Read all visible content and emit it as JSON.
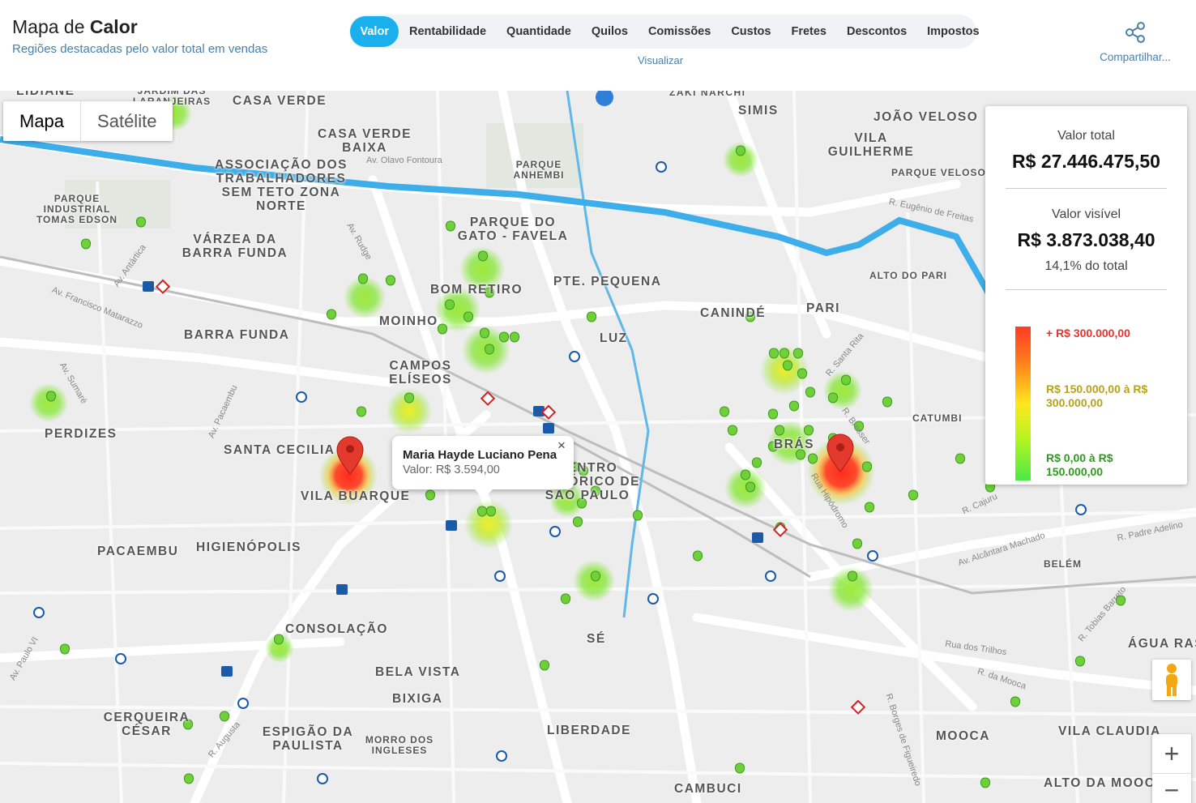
{
  "header": {
    "title_prefix": "Mapa de ",
    "title_bold": "Calor",
    "subtitle": "Regiões destacadas pelo valor total em vendas",
    "tabs": [
      "Valor",
      "Rentabilidade",
      "Quantidade",
      "Quilos",
      "Comissões",
      "Custos",
      "Fretes",
      "Descontos",
      "Impostos"
    ],
    "active_tab": "Valor",
    "visualizar_label": "Visualizar",
    "share_label": "Compartilhar..."
  },
  "map": {
    "map_type_buttons": [
      "Mapa",
      "Satélite"
    ],
    "active_map_type": "Mapa",
    "labels": [
      "CASA VERDE",
      "CASA VERDE BAIXA",
      "ASSOCIAÇÃO DOS TRABALHADORES SEM TETO ZONA NORTE",
      "PARQUE ANHEMBI",
      "SIMIS",
      "JOÃO VELOSO",
      "VILA GUILHERME",
      "PARQUE VELOSO",
      "PARQUE INDUSTRIAL TOMAS EDSON",
      "VÁRZEA DA BARRA FUNDA",
      "PARQUE DO GATO - FAVELA",
      "BOM RETIRO",
      "PTE. PEQUENA",
      "MOINHO",
      "CANINDÉ",
      "PARI",
      "ALTO DO PARI",
      "BARRA FUNDA",
      "LUZ",
      "CAMPOS ELÍSEOS",
      "PERDIZES",
      "SANTA CECILIA",
      "VILA BUARQUE",
      "CENTRO HISTÓRICO DE SÃO PAULO",
      "CATUMBI",
      "BRÁS",
      "PACAEMBU",
      "HIGIENÓPOLIS",
      "BELÉM",
      "CONSOLAÇÃO",
      "SÉ",
      "BELA VISTA",
      "BIXIGA",
      "ÁGUA RASA",
      "CERQUEIRA CÉSAR",
      "ESPIGÃO DA PAULISTA",
      "MORRO DOS INGLESES",
      "LIBERDADE",
      "MOOCA",
      "VILA CLAUDIA",
      "CAMBUCI",
      "ALTO DA MOOCA",
      "ZAKI NARCHI",
      "LIDIANE",
      "JARDIM DAS LARANJEIRAS"
    ],
    "streets": [
      "Av. Olavo Fontoura",
      "Av. Francisco Matarazzo",
      "Av. Antártica",
      "Av. Sumaré",
      "Av. Pacaembu",
      "Av. Rudge",
      "R. Eugênio de Freitas",
      "R. Santa Rita",
      "R. Bresser",
      "Av. Alcântara Machado",
      "R. Padre Adelino",
      "R. Tobias Barreto",
      "Rua dos Trilhos",
      "R. da Mooca",
      "R. Borges de Figueiredo",
      "Av. Paulo VI",
      "R. Augusta",
      "Rua Hipódromo",
      "R. Cajuru"
    ],
    "place_pin": "Maria Hayde Luciano Pena",
    "heat_intensity_note": "hotspots"
  },
  "legend": {
    "total_label": "Valor total",
    "total_value": "R$ 27.446.475,50",
    "visible_label": "Valor visível",
    "visible_value": "R$ 3.873.038,40",
    "visible_percent": "14,1% do total",
    "high_label": "+ R$ 300.000,00",
    "mid_label": "R$ 150.000,00 à R$ 300.000,00",
    "low_label": "R$ 0,00 à R$ 150.000,00",
    "colors": {
      "high": "#e8332b",
      "mid": "#b8a21a",
      "low": "#2e9a1f"
    }
  },
  "popup": {
    "name": "Maria Hayde Luciano Pena",
    "value": "Valor: R$ 3.594,00",
    "close": "×"
  },
  "controls": {
    "zoom_in": "+",
    "zoom_out": "−"
  }
}
